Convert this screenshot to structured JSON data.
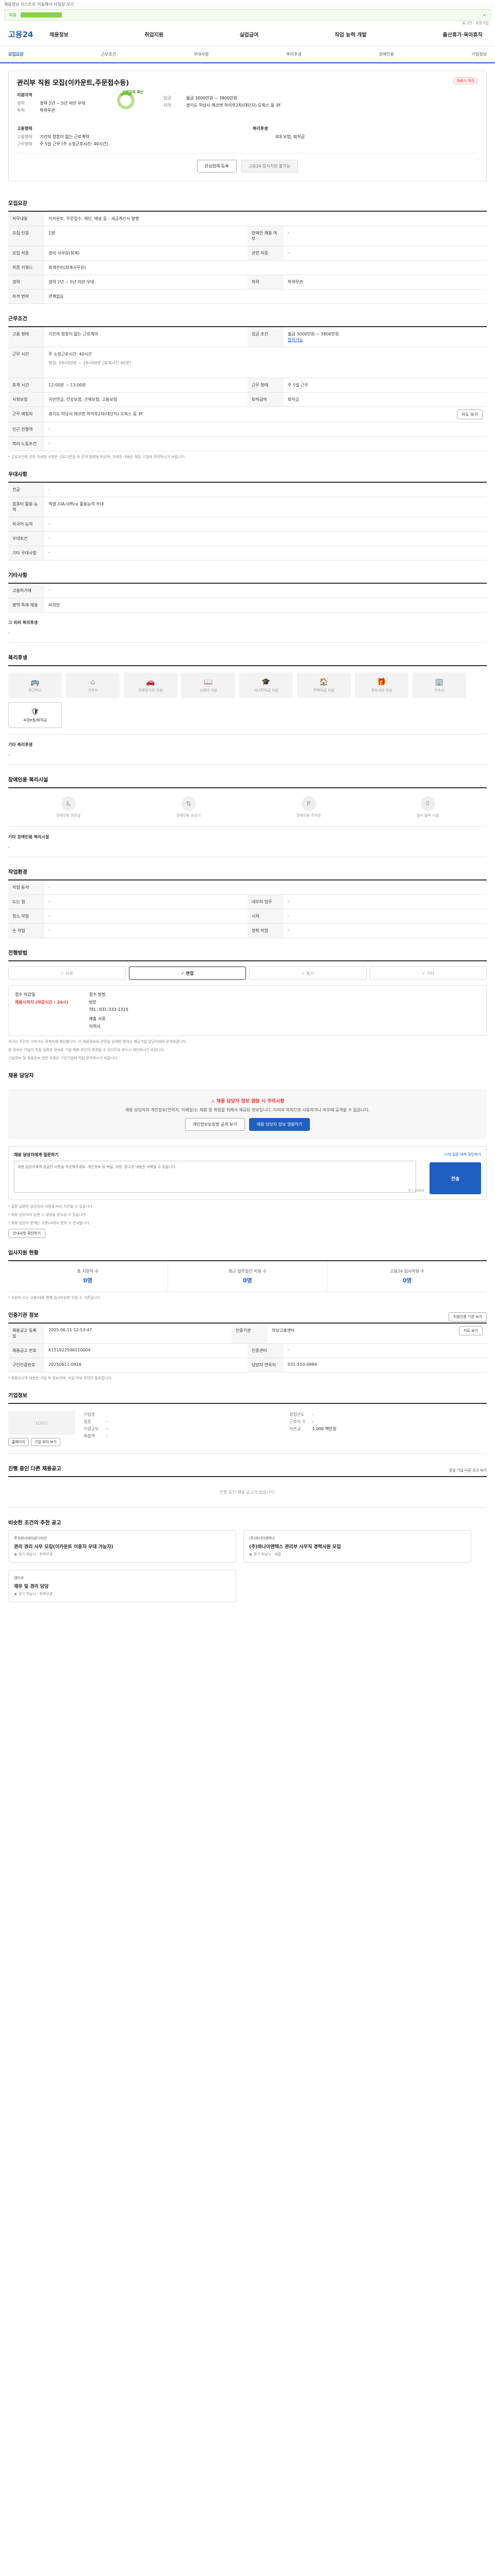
{
  "top": {
    "notice": "채용정보 리스트로 이동해서 사업장 보기",
    "progress_label": "지원"
  },
  "gnb": {
    "logo": "고용24",
    "menu": [
      "채용정보",
      "취업지원",
      "실업급여",
      "직업 능력 개발",
      "출산휴가·육아휴직"
    ],
    "login": "로그인 · 회원가입"
  },
  "subnav": {
    "items": [
      "모집요강",
      "근무조건",
      "우대사항",
      "복리후생",
      "장애인용",
      "기업정보"
    ]
  },
  "summary": {
    "tag": "채용시 마감",
    "title": "관리부 직원 모집(이카운트,주문접수등)",
    "company_label": "지원자격",
    "rows": [
      {
        "k": "경력",
        "v": "경력 2년 ~ 5년 미만 우대"
      },
      {
        "k": "학력",
        "v": "학력무관"
      }
    ],
    "donut_label": "지원자격 확인",
    "right_rows": [
      {
        "k": "임금",
        "v": "월급 3000만원 ~ 3800만원"
      },
      {
        "k": "지역",
        "v": "경기도 하남시 에코앤 하이루2차(대단지) 오피스 동 3F"
      }
    ],
    "work_title": "고용형태",
    "work_rows": [
      {
        "k": "고용형태",
        "v": "기간의 정함이 없는 근로계약"
      },
      {
        "k": "근무형태",
        "v": "주 5일 근무 (주 소정근로시간: 40시간)"
      }
    ],
    "welfare_title": "복리후생",
    "welfare_rows": [
      {
        "k": "",
        "v": "4대 보험, 퇴직금"
      }
    ],
    "btn_interest": "관심업체 등록",
    "btn_apply": "고용24 입사지원 불가능"
  },
  "recruit": {
    "title": "모집요강",
    "duty_title": "직무내용",
    "duty": "이카운트, 주문접수, 재단, 배송 등 - 세금계산서 발행",
    "rows": [
      {
        "k": "모집 인원",
        "v": "1명",
        "k2": "장애인 채용 여부",
        "v2": "-"
      },
      {
        "k": "모집 직종",
        "v": "경리 사무원(회계)",
        "k2": "관련 직종",
        "v2": "-"
      },
      {
        "k": "직종 키워드",
        "v": "회계관리(회계사무원)",
        "k2": "",
        "v2": ""
      },
      {
        "k": "경력",
        "v": "경력 2년 ~ 5년 미만 우대",
        "k2": "학력",
        "v2": "학력무관"
      },
      {
        "k": "자격 면허",
        "v": "관계없음",
        "k2": "",
        "v2": ""
      }
    ]
  },
  "work": {
    "title": "근무조건",
    "rows": [
      {
        "k": "고용 형태",
        "v": "기간의 정함이 없는 근로계약",
        "k2": "임금 조건",
        "v2": "월급 3000만원 ~ 3800만원",
        "extra": "협의가능"
      },
      {
        "k": "근무 시간",
        "v": "주 소정근로시간: 40시간",
        "sub": "평일: 09시00분 ~ 18시00분 (휴게시간 60분)",
        "k2": "",
        "v2": ""
      },
      {
        "k": "휴게 시간",
        "v": "12:00분 ~ 13:00분",
        "k2": "근무 형태",
        "v2": "주 5일 근무"
      },
      {
        "k": "사회보험",
        "v": "국민연금, 건강보험, 산재보험, 고용보험",
        "k2": "퇴직급여",
        "v2": "퇴직금"
      },
      {
        "k": "근무 예정지",
        "v": "경기도 하남시 에코앤 하이루2차(대단지) 오피스 동 3F",
        "k2": "",
        "v2": "",
        "btn": "지도 보기"
      },
      {
        "k": "인근 전철역",
        "v": "-",
        "k2": "",
        "v2": ""
      },
      {
        "k": "복리 노동조건",
        "v": "-",
        "k2": "",
        "v2": ""
      }
    ],
    "note": "* 근로조건에 관한 자세한 사항은 근로기준법 등 관계 법령에 따르며, 자세한 내용은 해당 기업에 문의하시기 바랍니다."
  },
  "prefer": {
    "title": "우대사항",
    "rows": [
      {
        "k": "전공",
        "v": "-"
      },
      {
        "k": "컴퓨터 활용 능력",
        "v": "엑셀 /OA-Office 활용능력 우대"
      },
      {
        "k": "외국어 능력",
        "v": "-"
      },
      {
        "k": "우대조건",
        "v": "-"
      },
      {
        "k": "기타 우대사항",
        "v": "-"
      }
    ]
  },
  "etc": {
    "title": "기타사항",
    "rows": [
      {
        "k": "고용허가제",
        "v": "-"
      },
      {
        "k": "병역 특례 채용",
        "v": "비희망"
      }
    ],
    "sub_title": "그 외의 복리후생",
    "sub_value": "-"
  },
  "welfare": {
    "title": "복리후생",
    "items": [
      {
        "label": "통근버스",
        "on": false
      },
      {
        "label": "기숙사",
        "on": false
      },
      {
        "label": "차량유지비 지원",
        "on": false
      },
      {
        "label": "교육비 지원",
        "on": false
      },
      {
        "label": "자녀학자금 지원",
        "on": false
      },
      {
        "label": "주택자금 지원",
        "on": false
      },
      {
        "label": "경조사비 지원",
        "on": false
      },
      {
        "label": "기숙사",
        "on": false
      },
      {
        "label": "4대보험/퇴직금",
        "on": true
      }
    ],
    "other_title": "기타 복리후생",
    "other_value": "-"
  },
  "disabled": {
    "title": "장애인용 복리시설",
    "items": [
      "장애인용 화장실",
      "장애인용 승강기",
      "장애인용 주차장",
      "점자 블럭 시설"
    ],
    "other_title": "기타 장애인용 복리시설",
    "other_value": "-"
  },
  "env": {
    "title": "작업환경",
    "rows": [
      {
        "k": "작업 동작",
        "v": "-"
      },
      {
        "k": "도는 힘",
        "v": "-",
        "k2": "내부의 업무",
        "v2": "-"
      },
      {
        "k": "청소 작업",
        "v": "-",
        "k2": "시력",
        "v2": "-"
      },
      {
        "k": "손 작업",
        "v": "-",
        "k2": "청취 작업",
        "v2": "-"
      }
    ]
  },
  "method": {
    "title": "전형방법",
    "items": [
      "서류",
      "면접",
      "필기",
      "기타"
    ],
    "active": 1
  },
  "apply": {
    "deadline_label": "접수 마감일",
    "deadline_value": "채용시까지 (마감시간 : 24시)",
    "method_label": "접수 방법",
    "methods": [
      "방문",
      "TEL: 031-333-1315",
      "제출 서류",
      "이력서"
    ]
  },
  "notes": [
    "자녀는 주인이 가져가는 관계자에 해당합니다. 이 채용정보와 관련된 상세한 문의는 해당기업 담당자에게 문의바랍니다.",
    "본 정보는 기업이 직접 등록한 정보로 기업 채용 조건이 변경될 수 있으므로 반드시 확인하시기 바랍니다.",
    "기업정보 및 채용정보 관련 사항은 구인기업에 직접 문의하시기 바랍니다."
  ],
  "contact": {
    "title": "채용 담당자",
    "warn_title": "채용 담당자 정보 열람 시 주의사항",
    "warn_text": "채용 담당자의 개인정보(연락처, 이메일)는 채용 및 취업을 위해서 제공된 정보입니다. 이외의 목적으로 사용하거나 외부에 공개할 수 없습니다.",
    "btn_detail": "개인정보보호법 공개 보기",
    "btn_view": "채용 담당자 정보 열람하기"
  },
  "question": {
    "title": "채용 담당자에게 질문하기",
    "right": "나의 질문 내역 확인하기",
    "placeholder": "채용 담당자에게 궁금한 사항을 작성해주세요. 개인정보 및 욕설, 비방, 광고성 내용은 삭제될 수 있습니다.",
    "count": "0 / 200자",
    "send": "전송",
    "notes": [
      "* 질문 답변은 담당자의 사정에 따라 지연될 수 있습니다.",
      "* 채용 담당자의 답변 시 알림을 받으실 수 있습니다.",
      "* 채용 담당자 분께는 고용24에서 문의 시 안내됩니다."
    ],
    "btn_notice": "안내사항 확인하기"
  },
  "stats": {
    "title": "입사지원 현황",
    "items": [
      {
        "label": "총 지원자 수",
        "value": "0명"
      },
      {
        "label": "최근 일주일간 지원 수",
        "value": "0명"
      },
      {
        "label": "고용24 입사지원 수",
        "value": "0명"
      }
    ],
    "note": "* 지원자 수는 고용24를 통해 입사지원한 인원 수 기준입니다."
  },
  "agency": {
    "title": "인증기관 정보",
    "btn": "지원인증 기관 보기",
    "rows": [
      {
        "k": "채용공고 등록일",
        "v": "2025.06.11 12:53:47",
        "k2": "인증기관",
        "v2": "하남고용센터",
        "btn": "지도 보기"
      },
      {
        "k": "채용공고 번호",
        "v": "K151922506110004",
        "k2": "인증센터",
        "v2": "-"
      },
      {
        "k": "구인인증번호",
        "v": "20250611-0916",
        "k2": "담당자 연락처",
        "v2": "031-510-0984"
      }
    ],
    "note": "* 채용공고의 내용은 기업 측 정보이며, 사실 여부 확인이 필요합니다."
  },
  "company": {
    "title": "기업정보",
    "logo": "LOGO",
    "name_label": "기업명",
    "name_value": "",
    "rows": [
      {
        "k": "업종",
        "v": "-"
      },
      {
        "k": "기업규모",
        "v": "-"
      },
      {
        "k": "매출액",
        "v": "-"
      }
    ],
    "rows2": [
      {
        "k": "설립년도",
        "v": "-"
      },
      {
        "k": "근로자 수",
        "v": "-"
      },
      {
        "k": "자본금",
        "v": "3,000 백만원"
      }
    ],
    "btn_homepage": "홈페이지",
    "btn_map": "기업 위치 보기"
  },
  "others": {
    "title": "진행 중인 다른 채용공고",
    "link": "동일 기업 다른 공고 보기",
    "empty": "진행 중인 채용 공고가 없습니다."
  },
  "similar": {
    "title": "비슷한 조건의 추천 공고",
    "cards": [
      {
        "org": "주식회사에이로디자인",
        "title": "관리 경리 사무 모집(이카운트 이용자 우대 가능자)",
        "a": "경기 하남시",
        "b": "학력무관"
      },
      {
        "org": "(주)하나이엔텍스",
        "title": "(주)하나이엔텍스 관리부 사무직 경력사원 모집",
        "a": "경기 하남시",
        "b": "대졸"
      },
      {
        "org": "엠티코",
        "title": "재무 및 경리 담당",
        "a": "경기 하남시",
        "b": "학력무관"
      }
    ]
  }
}
